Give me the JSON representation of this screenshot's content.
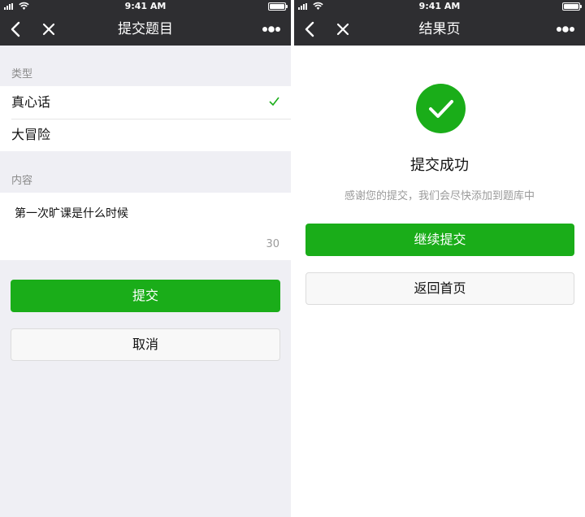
{
  "status_bar": {
    "time": "9:41 AM",
    "battery_level": 1.0
  },
  "left": {
    "nav_title": "提交题目",
    "type_label": "类型",
    "type_options": [
      {
        "label": "真心话",
        "selected": true
      },
      {
        "label": "大冒险",
        "selected": false
      }
    ],
    "content_label": "内容",
    "content_value": "第一次旷课是什么时候",
    "char_count": "30",
    "submit_label": "提交",
    "cancel_label": "取消"
  },
  "right": {
    "nav_title": "结果页",
    "result_title": "提交成功",
    "result_desc": "感谢您的提交，我们会尽快添加到题库中",
    "continue_label": "继续提交",
    "home_label": "返回首页"
  },
  "colors": {
    "navbar": "#2e2e31",
    "primary": "#1aad19",
    "background": "#efeff4"
  },
  "icons": [
    "back-icon",
    "close-icon",
    "more-icon",
    "check-icon",
    "success-check-icon",
    "signal-icon",
    "wifi-icon",
    "battery-icon"
  ]
}
